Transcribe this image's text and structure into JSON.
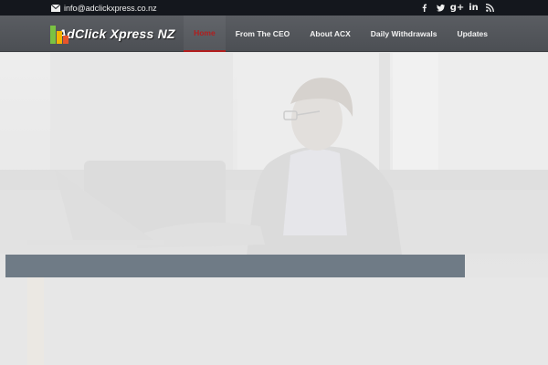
{
  "topbar": {
    "email": "info@adclickxpress.co.nz",
    "icons": [
      "envelope-icon",
      "facebook-icon",
      "twitter-icon",
      "google-plus-icon",
      "linkedin-icon",
      "rss-icon"
    ]
  },
  "header": {
    "logo_text": "AdClick Xpress NZ"
  },
  "nav": {
    "items": [
      {
        "label": "Home",
        "active": true
      },
      {
        "label": "From The CEO",
        "active": false
      },
      {
        "label": "About ACX",
        "active": false
      },
      {
        "label": "Daily Withdrawals",
        "active": false
      },
      {
        "label": "Updates",
        "active": false
      }
    ]
  },
  "colors": {
    "topbar_bg": "#14171d",
    "header_bg": "#54575c",
    "nav_active": "#b21e1e",
    "caption_bar": "#6f7b86"
  }
}
